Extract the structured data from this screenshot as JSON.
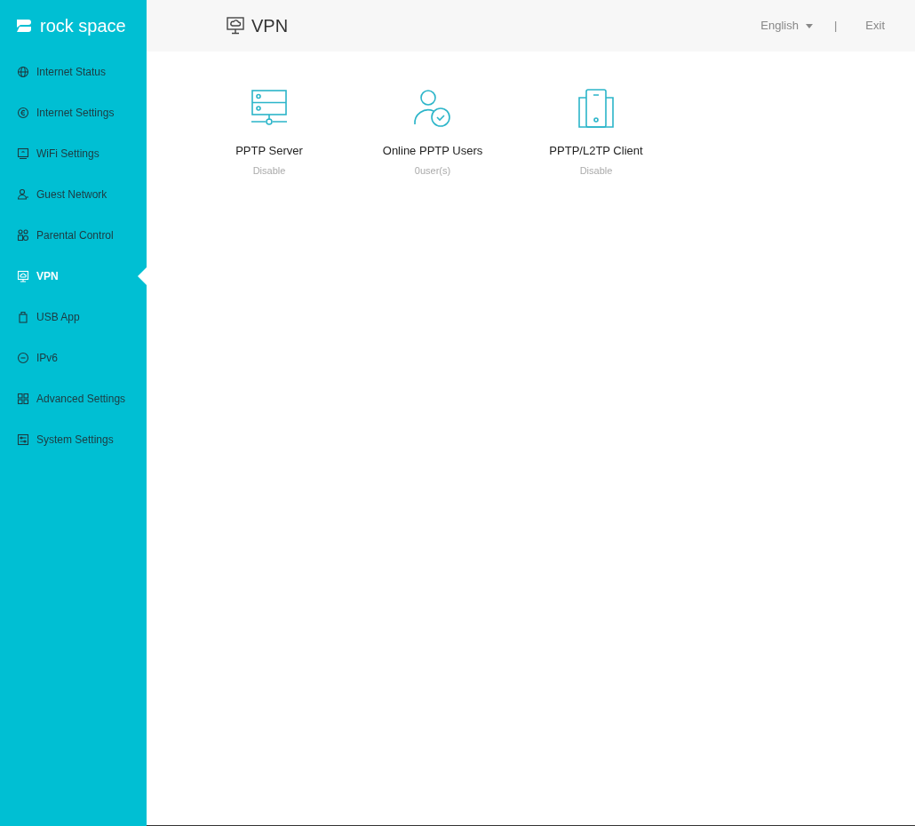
{
  "logo": {
    "text": "rock space"
  },
  "sidebar": {
    "items": [
      {
        "label": "Internet Status",
        "selected": false
      },
      {
        "label": "Internet Settings",
        "selected": false
      },
      {
        "label": "WiFi Settings",
        "selected": false
      },
      {
        "label": "Guest Network",
        "selected": false
      },
      {
        "label": "Parental Control",
        "selected": false
      },
      {
        "label": "VPN",
        "selected": true
      },
      {
        "label": "USB App",
        "selected": false
      },
      {
        "label": "IPv6",
        "selected": false
      },
      {
        "label": "Advanced Settings",
        "selected": false
      },
      {
        "label": "System Settings",
        "selected": false
      }
    ]
  },
  "header": {
    "title": "VPN",
    "language": "English",
    "separator": "|",
    "exit": "Exit"
  },
  "tiles": [
    {
      "title": "PPTP Server",
      "status": "Disable"
    },
    {
      "title": "Online PPTP Users",
      "status": "0user(s)"
    },
    {
      "title": "PPTP/L2TP Client",
      "status": "Disable"
    }
  ]
}
